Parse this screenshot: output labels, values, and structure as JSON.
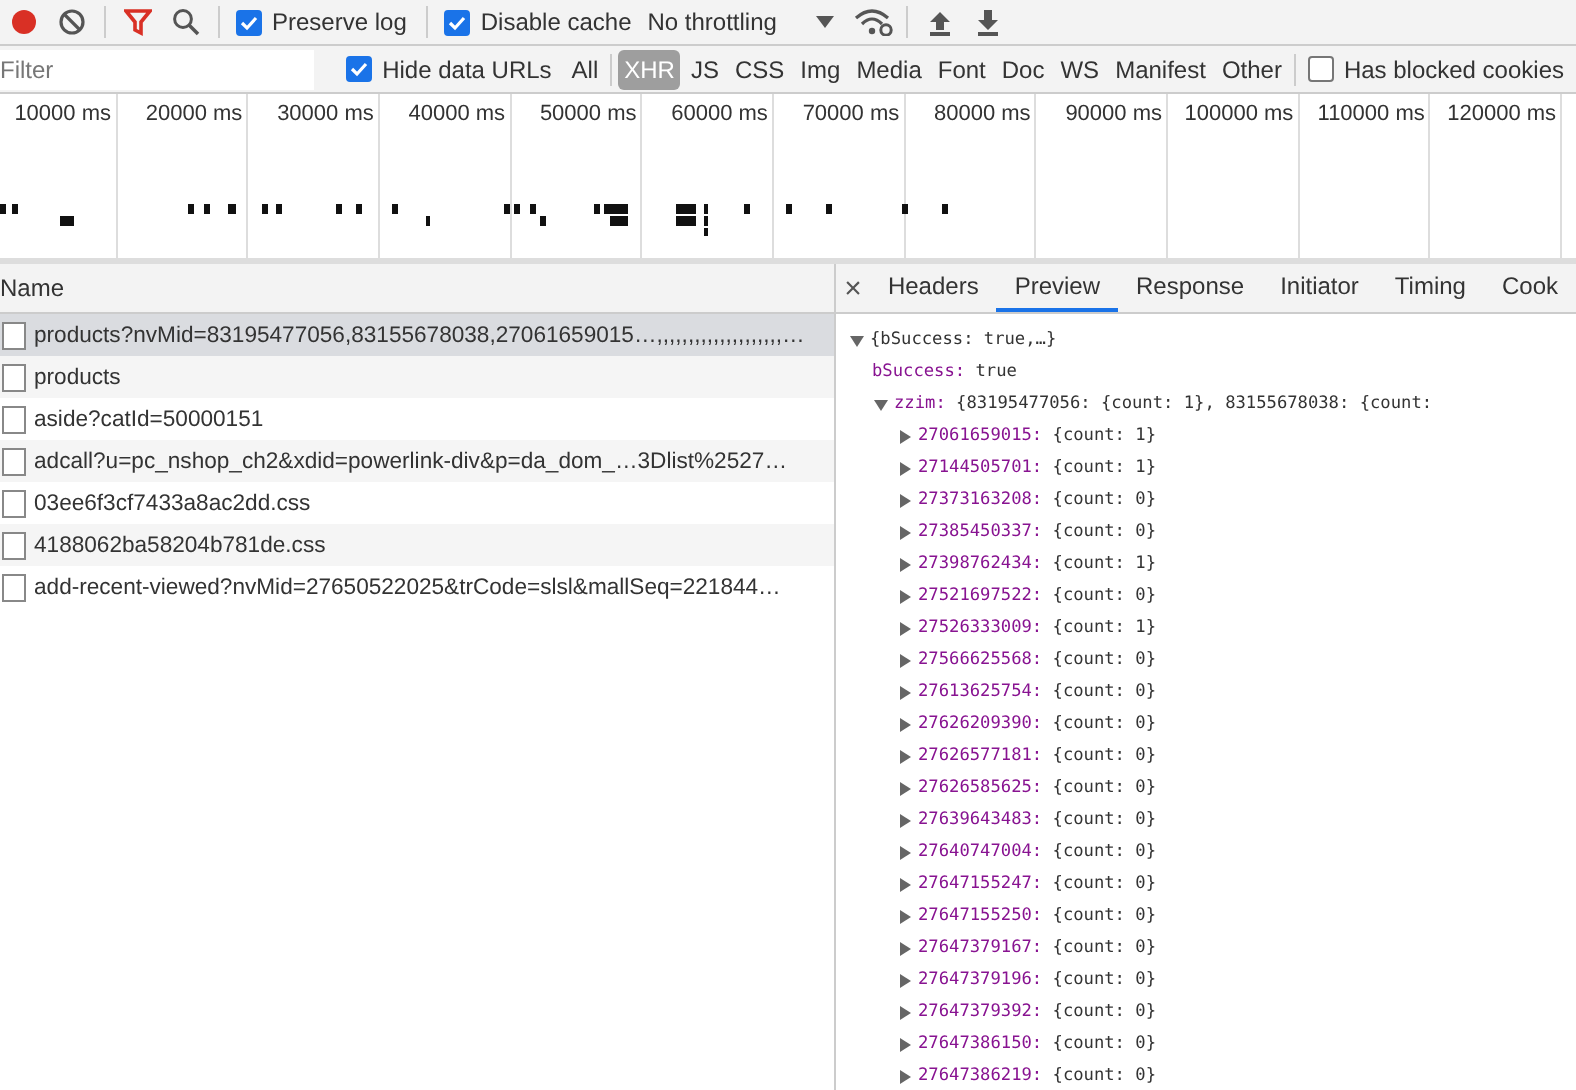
{
  "toolbar": {
    "recording": true,
    "filter_active": true,
    "checkboxes": [
      {
        "label": "Preserve log",
        "checked": true
      },
      {
        "label": "Disable cache",
        "checked": true
      }
    ],
    "throttling": "No throttling"
  },
  "filter_bar": {
    "placeholder": "Filter",
    "hide_data_urls": {
      "label": "Hide data URLs",
      "checked": true
    },
    "types": [
      {
        "label": "All",
        "selected": false
      },
      {
        "label": "XHR",
        "selected": true
      },
      {
        "label": "JS",
        "selected": false
      },
      {
        "label": "CSS",
        "selected": false
      },
      {
        "label": "Img",
        "selected": false
      },
      {
        "label": "Media",
        "selected": false
      },
      {
        "label": "Font",
        "selected": false
      },
      {
        "label": "Doc",
        "selected": false
      },
      {
        "label": "WS",
        "selected": false
      },
      {
        "label": "Manifest",
        "selected": false
      },
      {
        "label": "Other",
        "selected": false
      }
    ],
    "blocked_cookies": {
      "label": "Has blocked cookies",
      "checked": false
    }
  },
  "timeline": {
    "ticks": [
      "10000 ms",
      "20000 ms",
      "30000 ms",
      "40000 ms",
      "50000 ms",
      "60000 ms",
      "70000 ms",
      "80000 ms",
      "90000 ms",
      "100000 ms",
      "110000 ms",
      "120000 ms"
    ]
  },
  "requests": {
    "column": "Name",
    "rows": [
      {
        "name": "products?nvMid=83195477056,83155678038,27061659015…,,,,,,,,,,,,,,,,,,,,…",
        "selected": true
      },
      {
        "name": "products",
        "selected": false
      },
      {
        "name": "aside?catId=50000151",
        "selected": false
      },
      {
        "name": "adcall?u=pc_nshop_ch2&xdid=powerlink-div&p=da_dom_…3Dlist%2527…",
        "selected": false
      },
      {
        "name": "03ee6f3cf7433a8ac2dd.css",
        "selected": false
      },
      {
        "name": "4188062ba58204b781de.css",
        "selected": false
      },
      {
        "name": "add-recent-viewed?nvMid=27650522025&trCode=slsl&mallSeq=221844…",
        "selected": false
      }
    ]
  },
  "details": {
    "close": "×",
    "tabs": [
      {
        "label": "Headers",
        "selected": false
      },
      {
        "label": "Preview",
        "selected": true
      },
      {
        "label": "Response",
        "selected": false
      },
      {
        "label": "Initiator",
        "selected": false
      },
      {
        "label": "Timing",
        "selected": false
      },
      {
        "label": "Cook",
        "selected": false
      }
    ],
    "preview": [
      {
        "summary": "{bSuccess: true,…}",
        "expanded": true,
        "children": [
          {
            "key": "bSuccess:",
            "value": "true"
          },
          {
            "key": "zzim:",
            "value": "{83195477056: {count: 1}, 83155678038: {count:",
            "expanded": true,
            "children": [
              {
                "key": "27061659015:",
                "value": "{count: 1}",
                "expanded": false
              },
              {
                "key": "27144505701:",
                "value": "{count: 1}",
                "expanded": false
              },
              {
                "key": "27373163208:",
                "value": "{count: 0}",
                "expanded": false
              },
              {
                "key": "27385450337:",
                "value": "{count: 0}",
                "expanded": false
              },
              {
                "key": "27398762434:",
                "value": "{count: 1}",
                "expanded": false
              },
              {
                "key": "27521697522:",
                "value": "{count: 0}",
                "expanded": false
              },
              {
                "key": "27526333009:",
                "value": "{count: 1}",
                "expanded": false
              },
              {
                "key": "27566625568:",
                "value": "{count: 0}",
                "expanded": false
              },
              {
                "key": "27613625754:",
                "value": "{count: 0}",
                "expanded": false
              },
              {
                "key": "27626209390:",
                "value": "{count: 0}",
                "expanded": false
              },
              {
                "key": "27626577181:",
                "value": "{count: 0}",
                "expanded": false
              },
              {
                "key": "27626585625:",
                "value": "{count: 0}",
                "expanded": false
              },
              {
                "key": "27639643483:",
                "value": "{count: 0}",
                "expanded": false
              },
              {
                "key": "27640747004:",
                "value": "{count: 0}",
                "expanded": false
              },
              {
                "key": "27647155247:",
                "value": "{count: 0}",
                "expanded": false
              },
              {
                "key": "27647155250:",
                "value": "{count: 0}",
                "expanded": false
              },
              {
                "key": "27647379167:",
                "value": "{count: 0}",
                "expanded": false
              },
              {
                "key": "27647379196:",
                "value": "{count: 0}",
                "expanded": false
              },
              {
                "key": "27647379392:",
                "value": "{count: 0}",
                "expanded": false
              },
              {
                "key": "27647386150:",
                "value": "{count: 0}",
                "expanded": false
              },
              {
                "key": "27647386219:",
                "value": "{count: 0}",
                "expanded": false
              }
            ]
          }
        ]
      }
    ]
  }
}
